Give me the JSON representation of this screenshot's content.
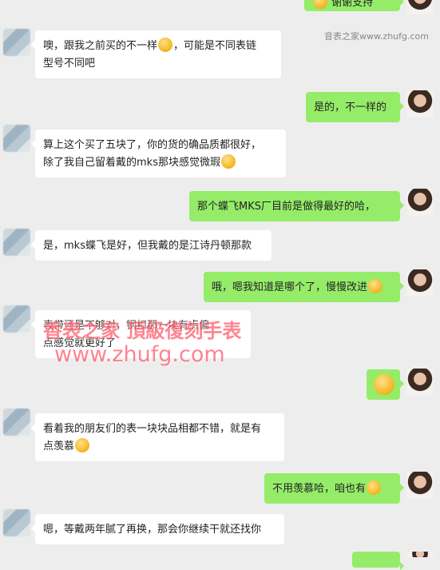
{
  "watermark": {
    "top_small": "音表之家www.zhufg.com",
    "line1": "香表之家  頂級復刻手表",
    "line2": "www.zhufg.com"
  },
  "messages": [
    {
      "side": "right",
      "text": "谢谢支持",
      "partial": true
    },
    {
      "side": "left",
      "lines": [
        "噢，跟我之前买的不一样",
        "，可能是不同表链",
        "型号不同吧"
      ]
    },
    {
      "side": "right",
      "text": "是的，不一样的"
    },
    {
      "side": "left",
      "lines": [
        "算上这个买了五块了，你的货的确品质都很好，",
        "除了我自己留着戴的mks那块感觉微瑕"
      ]
    },
    {
      "side": "right",
      "text": "那个蝶飞MKS厂目前是做得最好的哈，"
    },
    {
      "side": "left",
      "lines": [
        "是，mks蝶飞是好，但我戴的是江诗丹顿那款"
      ]
    },
    {
      "side": "right",
      "text": "哦，嗯我知道是哪个了，慢慢改进"
    },
    {
      "side": "left",
      "lines": [
        "表带还是不够对，钢扣那一块有点偏",
        "点感觉就更好了"
      ]
    },
    {
      "side": "right",
      "text": ""
    },
    {
      "side": "left",
      "lines": [
        "看着我的朋友们的表一块块品相都不错，就是有",
        "点羡慕"
      ]
    },
    {
      "side": "right",
      "text": "不用羡慕哈，咱也有"
    },
    {
      "side": "left",
      "lines": [
        "嗯，等戴两年腻了再换，那会你继续干就还找你"
      ]
    }
  ]
}
